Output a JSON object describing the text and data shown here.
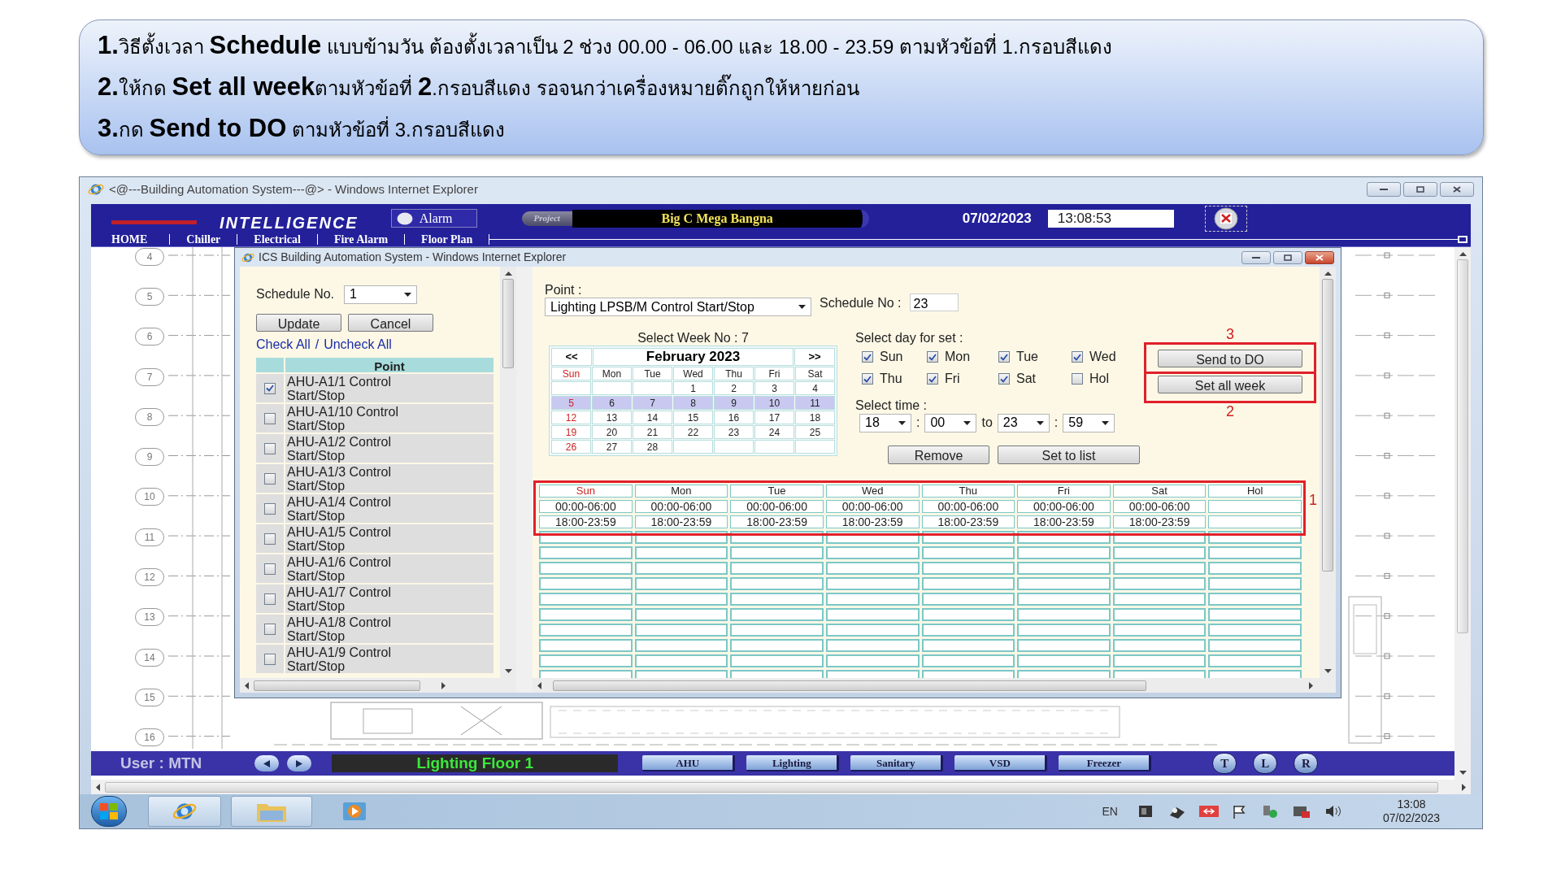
{
  "instructions": [
    "**1.**วิธีตั้งเวลา **Schedule** แบบข้ามวัน ต้องตั้งเวลาเป็น 2 ช่วง 00.00 - 06.00 และ 18.00 - 23.59 ตามหัวข้อที่ 1.กรอบสีแดง",
    "**2.**ให้กด **Set all week**ตามหัวข้อที่ **2**.กรอบสีแดง รอจนกว่าเครื่องหมายติ๊กถูกให้หายก่อน",
    "**3.**กด **Send to DO** ตามหัวข้อที่ 3.กรอบสีแดง"
  ],
  "browser": {
    "title": "<@---Building Automation System---@> - Windows Internet Explorer"
  },
  "header": {
    "logo": "INTELLIGENCE",
    "alarm": "Alarm",
    "project_label": "Project",
    "project": "Big C Mega Bangna",
    "date": "07/02/2023",
    "time": "13:08:53"
  },
  "nav": [
    "HOME",
    "Chiller",
    "Electrical",
    "Fire Alarm",
    "Floor Plan"
  ],
  "floor_plan": {
    "axis_labels": [
      "4",
      "5",
      "6",
      "7",
      "8",
      "9",
      "10",
      "11",
      "12",
      "13",
      "14",
      "15",
      "16"
    ]
  },
  "popup": {
    "title": "ICS Building Automation System - Windows Internet Explorer",
    "schedule_label": "Schedule No.",
    "schedule_value": "1",
    "buttons": [
      "Update",
      "Cancel"
    ],
    "links": [
      "Check All",
      "Uncheck All"
    ],
    "link_separator": "/",
    "point_header": "Point",
    "points": [
      {
        "name": "AHU-A1/1 Control Start/Stop",
        "checked": true
      },
      {
        "name": "AHU-A1/10 Control Start/Stop",
        "checked": false
      },
      {
        "name": "AHU-A1/2 Control Start/Stop",
        "checked": false
      },
      {
        "name": "AHU-A1/3 Control Start/Stop",
        "checked": false
      },
      {
        "name": "AHU-A1/4 Control Start/Stop",
        "checked": false
      },
      {
        "name": "AHU-A1/5 Control Start/Stop",
        "checked": false
      },
      {
        "name": "AHU-A1/6 Control Start/Stop",
        "checked": false
      },
      {
        "name": "AHU-A1/7 Control Start/Stop",
        "checked": false
      },
      {
        "name": "AHU-A1/8 Control Start/Stop",
        "checked": false
      },
      {
        "name": "AHU-A1/9 Control Start/Stop",
        "checked": false
      }
    ],
    "point_label": "Point :",
    "point_value": "Lighting LPSB/M Control Start/Stop",
    "schedule_no_label": "Schedule No :",
    "schedule_no": "23",
    "calendar": {
      "week_label": "Select Week No :",
      "week": "7",
      "prev": "<<",
      "next": ">>",
      "month": "February 2023",
      "weekdays": [
        {
          "label": "Sun",
          "weekend": true
        },
        {
          "label": "Mon",
          "weekend": false
        },
        {
          "label": "Tue",
          "weekend": false
        },
        {
          "label": "Wed",
          "weekend": false
        },
        {
          "label": "Thu",
          "weekend": false
        },
        {
          "label": "Fri",
          "weekend": false
        },
        {
          "label": "Sat",
          "weekend": false
        }
      ],
      "weeks": [
        {
          "cells": [
            {
              "kind": "blank"
            },
            {
              "kind": "blank"
            },
            {
              "kind": "blank"
            },
            {
              "kind": "day",
              "label": "1"
            },
            {
              "kind": "day",
              "label": "2"
            },
            {
              "kind": "day",
              "label": "3"
            },
            {
              "kind": "day",
              "label": "4"
            }
          ],
          "selected": false
        },
        {
          "cells": [
            {
              "kind": "day",
              "label": "5"
            },
            {
              "kind": "day",
              "label": "6"
            },
            {
              "kind": "day",
              "label": "7"
            },
            {
              "kind": "day",
              "label": "8"
            },
            {
              "kind": "day",
              "label": "9"
            },
            {
              "kind": "day",
              "label": "10"
            },
            {
              "kind": "day",
              "label": "11"
            }
          ],
          "selected": true
        },
        {
          "cells": [
            {
              "kind": "day",
              "label": "12"
            },
            {
              "kind": "day",
              "label": "13"
            },
            {
              "kind": "day",
              "label": "14"
            },
            {
              "kind": "day",
              "label": "15"
            },
            {
              "kind": "day",
              "label": "16"
            },
            {
              "kind": "day",
              "label": "17"
            },
            {
              "kind": "day",
              "label": "18"
            }
          ],
          "selected": false
        },
        {
          "cells": [
            {
              "kind": "day",
              "label": "19"
            },
            {
              "kind": "day",
              "label": "20"
            },
            {
              "kind": "day",
              "label": "21"
            },
            {
              "kind": "day",
              "label": "22"
            },
            {
              "kind": "day",
              "label": "23"
            },
            {
              "kind": "day",
              "label": "24"
            },
            {
              "kind": "day",
              "label": "25"
            }
          ],
          "selected": false
        },
        {
          "cells": [
            {
              "kind": "day",
              "label": "26"
            },
            {
              "kind": "day",
              "label": "27"
            },
            {
              "kind": "day",
              "label": "28"
            },
            {
              "kind": "blank"
            },
            {
              "kind": "blank"
            },
            {
              "kind": "blank"
            },
            {
              "kind": "blank"
            }
          ],
          "selected": false
        }
      ]
    },
    "day_label": "Select day for set :",
    "days": [
      {
        "label": "Sun",
        "checked": true
      },
      {
        "label": "Mon",
        "checked": true
      },
      {
        "label": "Tue",
        "checked": true
      },
      {
        "label": "Wed",
        "checked": true
      },
      {
        "label": "Thu",
        "checked": true
      },
      {
        "label": "Fri",
        "checked": true
      },
      {
        "label": "Sat",
        "checked": true
      },
      {
        "label": "Hol",
        "checked": false
      }
    ],
    "time_label": "Select time :",
    "time": [
      {
        "kind": "select",
        "value": "18"
      },
      {
        "kind": "text",
        "value": ":"
      },
      {
        "kind": "select",
        "value": "00"
      },
      {
        "kind": "text",
        "value": "to"
      },
      {
        "kind": "select",
        "value": "23"
      },
      {
        "kind": "text",
        "value": ":"
      },
      {
        "kind": "select",
        "value": "59"
      }
    ],
    "actions": [
      "Remove",
      "Set to list"
    ],
    "send_button": "Send to DO",
    "set_all_button": "Set all week",
    "markers": {
      "send": "3",
      "set_all": "2",
      "table": "1"
    },
    "table": {
      "columns": [
        {
          "label": "Sun",
          "weekend": true
        },
        {
          "label": "Mon",
          "weekend": false
        },
        {
          "label": "Tue",
          "weekend": false
        },
        {
          "label": "Wed",
          "weekend": false
        },
        {
          "label": "Thu",
          "weekend": false
        },
        {
          "label": "Fri",
          "weekend": false
        },
        {
          "label": "Sat",
          "weekend": false
        },
        {
          "label": "Hol",
          "weekend": false
        }
      ],
      "rows": [
        [
          "00:00-06:00",
          "00:00-06:00",
          "00:00-06:00",
          "00:00-06:00",
          "00:00-06:00",
          "00:00-06:00",
          "00:00-06:00"
        ],
        [
          "18:00-23:59",
          "18:00-23:59",
          "18:00-23:59",
          "18:00-23:59",
          "18:00-23:59",
          "18:00-23:59",
          "18:00-23:59"
        ]
      ]
    }
  },
  "status_bar": {
    "user": "User : MTN",
    "floor": "Lighting Floor 1",
    "systems": [
      "AHU",
      "Lighting",
      "Sanitary",
      "VSD",
      "Freezer"
    ],
    "views": [
      "T",
      "L",
      "R"
    ]
  },
  "taskbar": {
    "language": "EN",
    "time": "13:08",
    "date": "07/02/2023"
  }
}
